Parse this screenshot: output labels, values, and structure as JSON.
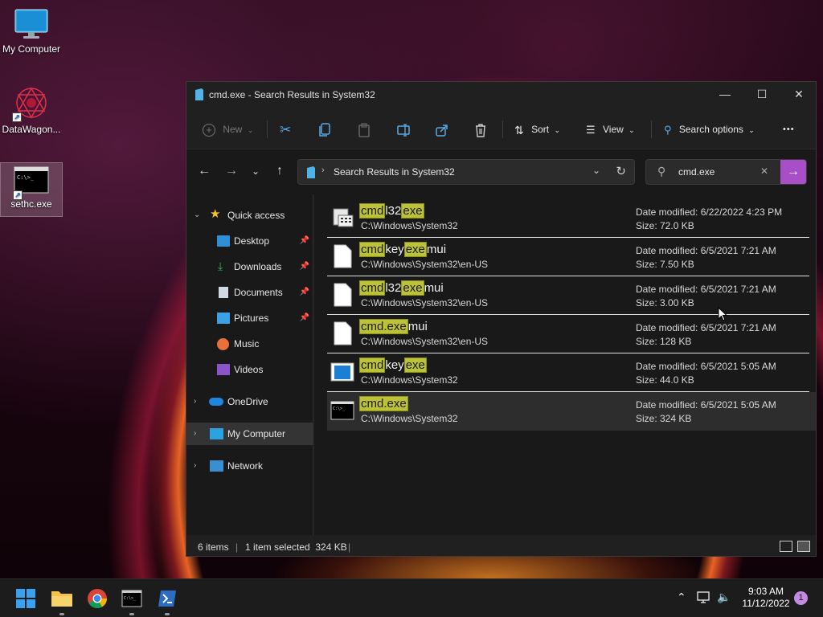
{
  "desktop": {
    "icons": [
      {
        "label": "My Computer"
      },
      {
        "label": "DataWagon..."
      },
      {
        "label": "sethc.exe"
      }
    ]
  },
  "window": {
    "title": "cmd.exe - Search Results in System32",
    "controls": {
      "minimize": "—",
      "maximize": "☐",
      "close": "✕"
    }
  },
  "toolbar": {
    "new_label": "New",
    "sort_label": "Sort",
    "view_label": "View",
    "search_options_label": "Search options",
    "more_label": "•••"
  },
  "address": {
    "path": "Search Results in System32",
    "search_value": "cmd.exe"
  },
  "nav": {
    "items": [
      {
        "label": "Quick access"
      },
      {
        "label": "Desktop"
      },
      {
        "label": "Downloads"
      },
      {
        "label": "Documents"
      },
      {
        "label": "Pictures"
      },
      {
        "label": "Music"
      },
      {
        "label": "Videos"
      },
      {
        "label": "OneDrive"
      },
      {
        "label": "My Computer"
      },
      {
        "label": "Network"
      }
    ]
  },
  "results": [
    {
      "name_parts": [
        "cmd",
        "l32",
        "exe"
      ],
      "path": "C:\\Windows\\System32",
      "date": "Date modified: 6/22/2022 4:23 PM",
      "size": "Size: 72.0 KB"
    },
    {
      "name_parts": [
        "cmd",
        "key",
        "exe",
        "mui"
      ],
      "path": "C:\\Windows\\System32\\en-US",
      "date": "Date modified: 6/5/2021 7:21 AM",
      "size": "Size: 7.50 KB"
    },
    {
      "name_parts": [
        "cmd",
        "l32",
        "exe",
        "mui"
      ],
      "path": "C:\\Windows\\System32\\en-US",
      "date": "Date modified: 6/5/2021 7:21 AM",
      "size": "Size: 3.00 KB"
    },
    {
      "name_parts": [
        "cmd.exe",
        "mui"
      ],
      "path": "C:\\Windows\\System32\\en-US",
      "date": "Date modified: 6/5/2021 7:21 AM",
      "size": "Size: 128 KB"
    },
    {
      "name_parts": [
        "cmd",
        "key",
        "exe"
      ],
      "path": "C:\\Windows\\System32",
      "date": "Date modified: 6/5/2021 5:05 AM",
      "size": "Size: 44.0 KB"
    },
    {
      "name_parts": [
        "cmd.exe"
      ],
      "path": "C:\\Windows\\System32",
      "date": "Date modified: 6/5/2021 5:05 AM",
      "size": "Size: 324 KB"
    }
  ],
  "status": {
    "count": "6 items",
    "selected": "1 item selected  324 KB"
  },
  "taskbar": {
    "time": "9:03 AM",
    "date": "11/12/2022",
    "notifications": "1"
  },
  "colors": {
    "highlight": "#bcc235",
    "accent": "#a84fc7",
    "window_bg": "#202020"
  }
}
